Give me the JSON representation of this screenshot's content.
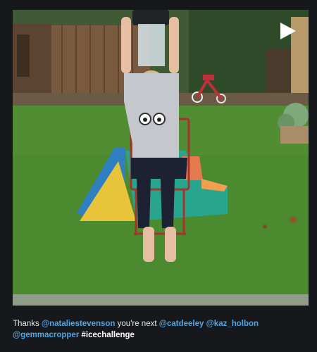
{
  "video": {
    "play_icon": "play-triangle-icon",
    "colors": {
      "background": "#16181b",
      "lawn": "#4c8a2f",
      "mention": "#4aa6e6"
    }
  },
  "caption": {
    "prefix": "Thanks ",
    "mention_1": "@nataliestevenson",
    "middle": " you're next ",
    "mention_2": "@catdeeley",
    "mention_3": "@kaz_holbon",
    "mention_4": "@gemmacropper",
    "hashtag": "#icechallenge"
  }
}
